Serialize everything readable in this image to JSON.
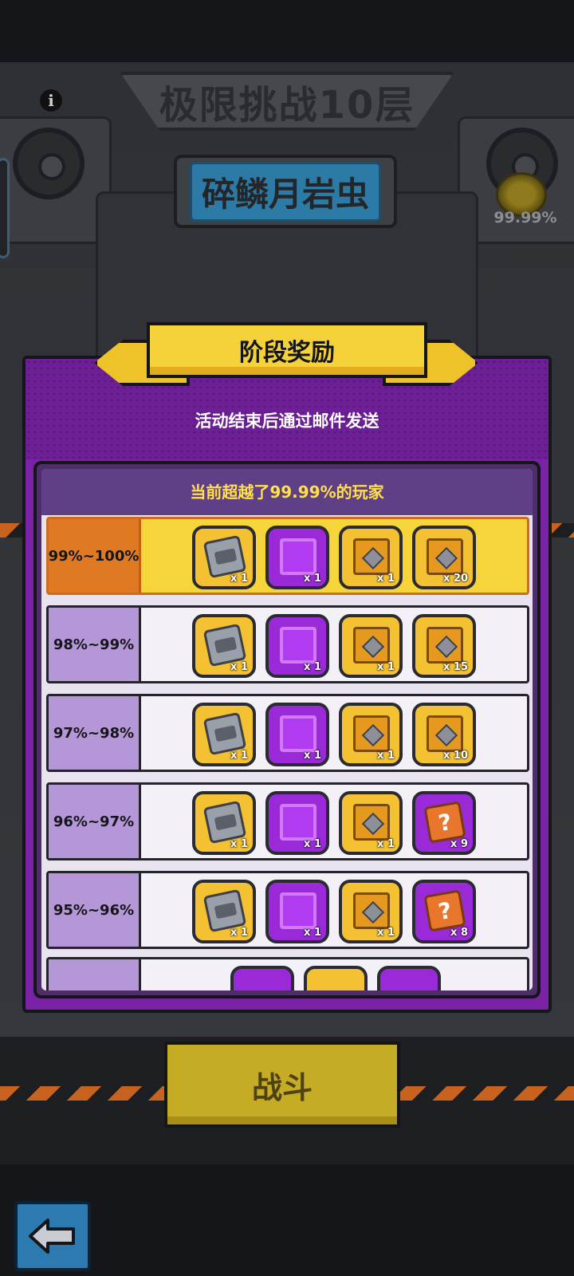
{
  "header": {
    "title": "极限挑战10层",
    "boss_name": "碎鳞月岩虫",
    "rank_percent": "99.99%"
  },
  "dialog": {
    "title": "阶段奖励",
    "subtitle": "活动结束后通过邮件发送",
    "list_header": "当前超越了99.99%的玩家",
    "tiers": [
      {
        "range": "99%~100%",
        "current": true,
        "items": [
          {
            "icon": "ticket-icon",
            "style": "gold",
            "qty": "x 1"
          },
          {
            "icon": "avatar-frame-icon",
            "style": "purple",
            "qty": "x 1"
          },
          {
            "icon": "chest-icon",
            "style": "gold",
            "qty": "x 1"
          },
          {
            "icon": "coin-chest-icon",
            "style": "gold",
            "qty": "x 20"
          }
        ]
      },
      {
        "range": "98%~99%",
        "current": false,
        "items": [
          {
            "icon": "ticket-icon",
            "style": "gold",
            "qty": "x 1"
          },
          {
            "icon": "avatar-frame-icon",
            "style": "purple",
            "qty": "x 1"
          },
          {
            "icon": "chest-icon",
            "style": "gold",
            "qty": "x 1"
          },
          {
            "icon": "coin-chest-icon",
            "style": "gold",
            "qty": "x 15"
          }
        ]
      },
      {
        "range": "97%~98%",
        "current": false,
        "items": [
          {
            "icon": "ticket-icon",
            "style": "gold",
            "qty": "x 1"
          },
          {
            "icon": "avatar-frame-icon",
            "style": "purple",
            "qty": "x 1"
          },
          {
            "icon": "chest-icon",
            "style": "gold",
            "qty": "x 1"
          },
          {
            "icon": "coin-chest-icon",
            "style": "gold",
            "qty": "x 10"
          }
        ]
      },
      {
        "range": "96%~97%",
        "current": false,
        "items": [
          {
            "icon": "ticket-icon",
            "style": "gold",
            "qty": "x 1"
          },
          {
            "icon": "avatar-frame-icon",
            "style": "purple",
            "qty": "x 1"
          },
          {
            "icon": "chest-icon",
            "style": "gold",
            "qty": "x 1"
          },
          {
            "icon": "puzzle-icon",
            "style": "purple",
            "qty": "x 9"
          }
        ]
      },
      {
        "range": "95%~96%",
        "current": false,
        "items": [
          {
            "icon": "ticket-icon",
            "style": "gold",
            "qty": "x 1"
          },
          {
            "icon": "avatar-frame-icon",
            "style": "purple",
            "qty": "x 1"
          },
          {
            "icon": "chest-icon",
            "style": "gold",
            "qty": "x 1"
          },
          {
            "icon": "puzzle-icon",
            "style": "purple",
            "qty": "x 8"
          }
        ]
      }
    ]
  },
  "actions": {
    "fight": "战斗"
  },
  "colors": {
    "dialog_purple": "#7a22a6",
    "banner_yellow": "#f6d23a",
    "current_row_orange": "#e07a22",
    "tier_lavender": "#b596d6",
    "header_text_yellow": "#ffe04a"
  }
}
